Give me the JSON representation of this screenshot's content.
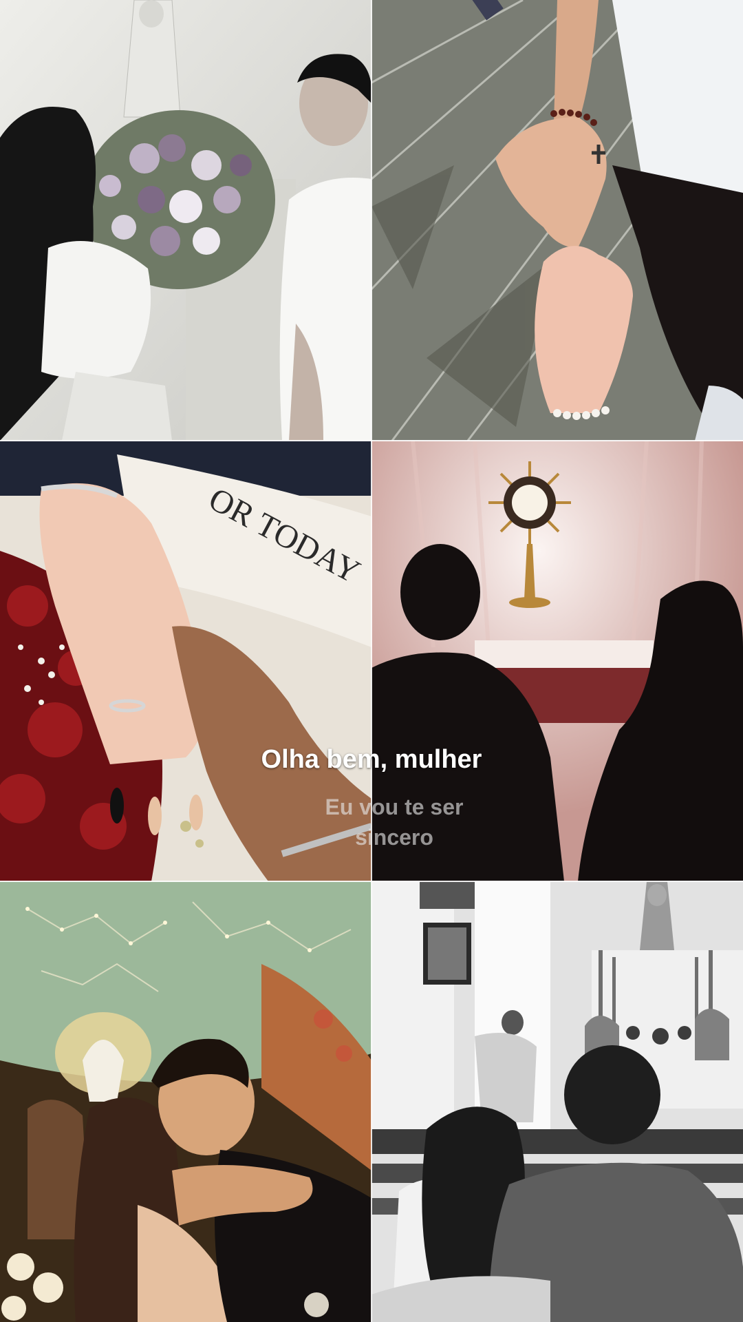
{
  "lyrics": {
    "current_line": "Olha bem, mulher",
    "next_line": "Eu vou te ser sincero"
  },
  "photos": [
    {
      "name": "couple-at-marian-statue-with-flowers",
      "tone": "muted-gray"
    },
    {
      "name": "holding-hands-with-rosaries",
      "tone": "desaturated"
    },
    {
      "name": "hands-with-rings-and-bouquet",
      "tone": "warm"
    },
    {
      "name": "couple-silhouette-before-monstrance",
      "tone": "backlit"
    },
    {
      "name": "couple-kissing-under-painted-ceiling",
      "tone": "warm-sepia"
    },
    {
      "name": "couple-embracing-in-church-pew",
      "tone": "black-and-white"
    }
  ],
  "colors": {
    "lyric_current": "#ffffff",
    "lyric_next": "#d9d9d9",
    "divider": "#ffffff"
  }
}
